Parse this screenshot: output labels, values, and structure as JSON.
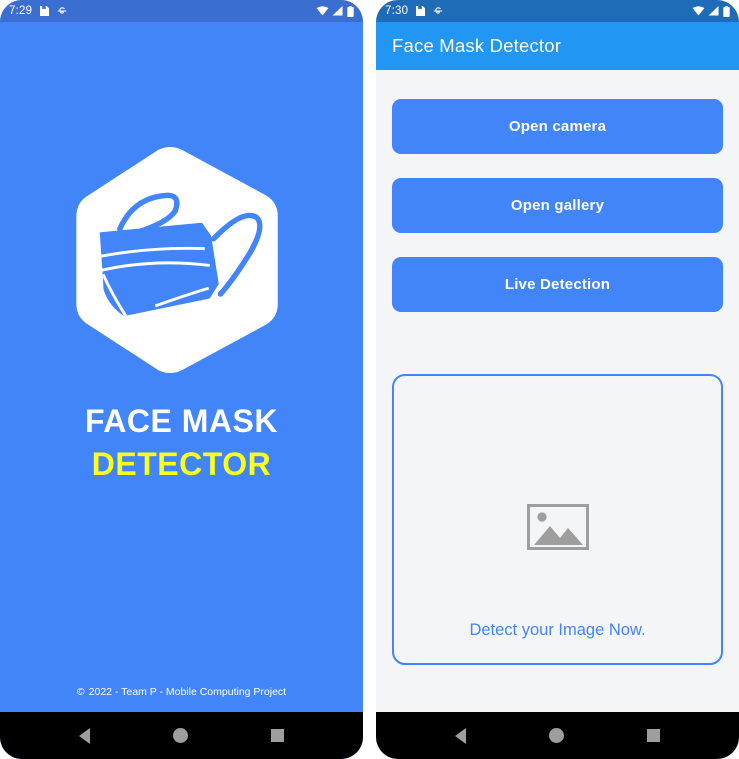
{
  "colors": {
    "splash_bg": "#4285F8",
    "appbar_bg": "#2196F3",
    "statusbar_dark": "#1E6BB8",
    "statusbar_splash": "#3A6FD1",
    "button_bg": "#4285F8",
    "accent_blue": "#4285F8",
    "title_yellow": "#FBFF1C",
    "content_bg": "#F4F5F7",
    "navbar_bg": "#000000",
    "nav_icon": "#9E9E9E",
    "placeholder_gray": "#9E9E9E"
  },
  "splash_screen": {
    "statusbar": {
      "clock": "7:29",
      "icons": [
        "save-icon",
        "stop-icon"
      ],
      "right_icons": [
        "wifi-icon",
        "signal-icon",
        "battery-icon"
      ]
    },
    "logo_name": "face-mask-hexagon-logo",
    "title_line1": "FACE MASK",
    "title_line2": "DETECTOR",
    "copyright_symbol": "©",
    "copyright_text": "2022 - Team P - Mobile Computing Project",
    "navbar": {
      "back_label": "back",
      "home_label": "home",
      "recents_label": "recents"
    }
  },
  "main_screen": {
    "statusbar": {
      "clock": "7:30",
      "icons": [
        "save-icon",
        "stop-icon"
      ],
      "right_icons": [
        "wifi-icon",
        "signal-icon",
        "battery-icon"
      ]
    },
    "appbar": {
      "title": "Face Mask Detector"
    },
    "buttons": [
      {
        "label": "Open camera",
        "name": "open-camera-button"
      },
      {
        "label": "Open gallery",
        "name": "open-gallery-button"
      },
      {
        "label": "Live Detection",
        "name": "live-detection-button"
      }
    ],
    "photo_card": {
      "placeholder_icon": "image-placeholder-icon",
      "hint": "Detect your Image Now."
    },
    "navbar": {
      "back_label": "back",
      "home_label": "home",
      "recents_label": "recents"
    }
  }
}
